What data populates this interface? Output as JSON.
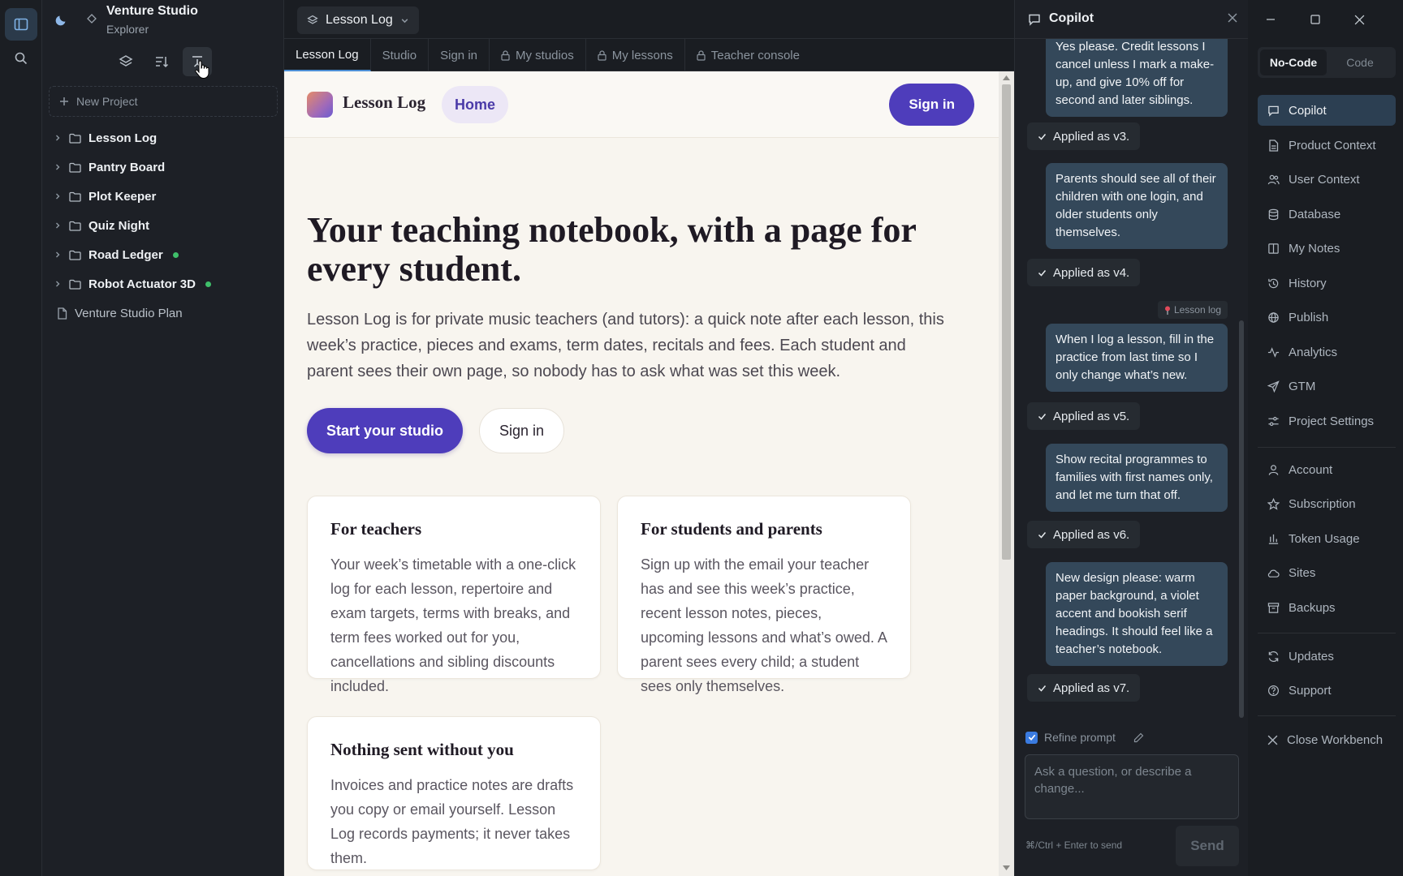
{
  "explorer": {
    "title": "Venture Studio",
    "subtitle": "Explorer",
    "new_project": "New Project",
    "projects": [
      {
        "name": "Lesson Log",
        "dot": false
      },
      {
        "name": "Pantry Board",
        "dot": false
      },
      {
        "name": "Plot Keeper",
        "dot": false
      },
      {
        "name": "Quiz Night",
        "dot": false
      },
      {
        "name": "Road Ledger",
        "dot": true
      },
      {
        "name": "Robot Actuator 3D",
        "dot": true
      }
    ],
    "doc": "Venture Studio Plan"
  },
  "center": {
    "project_select": "Lesson Log",
    "tabs": [
      {
        "label": "Lesson Log",
        "locked": false,
        "active": true
      },
      {
        "label": "Studio",
        "locked": false,
        "active": false
      },
      {
        "label": "Sign in",
        "locked": false,
        "active": false
      },
      {
        "label": "My studios",
        "locked": true,
        "active": false
      },
      {
        "label": "My lessons",
        "locked": true,
        "active": false
      },
      {
        "label": "Teacher console",
        "locked": true,
        "active": false
      }
    ]
  },
  "site": {
    "logo": "Lesson Log",
    "home": "Home",
    "nav_signin": "Sign in",
    "hero_title": "Your teaching notebook, with a page for every student.",
    "hero_body": "Lesson Log is for private music teachers (and tutors): a quick note after each lesson, this week’s practice, pieces and exams, term dates, recitals and fees. Each student and parent sees their own page, so nobody has to ask what was set this week.",
    "cta_primary": "Start your studio",
    "cta_secondary": "Sign in",
    "cards": [
      {
        "title": "For teachers",
        "body": "Your week’s timetable with a one-click log for each lesson, repertoire and exam targets, terms with breaks, and term fees worked out for you, cancellations and sibling discounts included."
      },
      {
        "title": "For students and parents",
        "body": "Sign up with the email your teacher has and see this week’s practice, recent lesson notes, pieces, upcoming lessons and what’s owed. A parent sees every child; a student sees only themselves."
      },
      {
        "title": "Nothing sent without you",
        "body": "Invoices and practice notes are drafts you copy or email yourself. Lesson Log records payments; it never takes them."
      }
    ],
    "accent": "#4e3dbb"
  },
  "copilot": {
    "title": "Copilot",
    "messages": {
      "m1": "Yes please. Credit lessons I cancel unless I mark a make-up, and give 10% off for second and later siblings.",
      "a3": "Applied as v3.",
      "m2": "Parents should see all of their children with one login, and older students only themselves.",
      "a4": "Applied as v4.",
      "ctx": "Lesson log",
      "m3": "When I log a lesson, fill in the practice from last time so I only change what’s new.",
      "a5": "Applied as v5.",
      "m4": "Show recital programmes to families with first names only, and let me turn that off.",
      "a6": "Applied as v6.",
      "m5": "New design please: warm paper background, a violet accent and bookish serif headings. It should feel like a teacher’s notebook.",
      "a7": "Applied as v7."
    },
    "refine_label": "Refine prompt",
    "refine_checked": true,
    "input_placeholder": "Ask a question, or describe a change...",
    "hint": "⌘/Ctrl + Enter to send",
    "send": "Send"
  },
  "rightnav": {
    "mode_nocode": "No-Code",
    "mode_code": "Code",
    "items": [
      {
        "label": "Copilot",
        "icon": "chat-icon"
      },
      {
        "label": "Product Context",
        "icon": "document-icon"
      },
      {
        "label": "User Context",
        "icon": "users-icon"
      },
      {
        "label": "Database",
        "icon": "database-icon"
      },
      {
        "label": "My Notes",
        "icon": "book-icon"
      },
      {
        "label": "History",
        "icon": "history-icon"
      },
      {
        "label": "Publish",
        "icon": "globe-icon"
      },
      {
        "label": "Analytics",
        "icon": "activity-icon"
      },
      {
        "label": "GTM",
        "icon": "send-icon"
      },
      {
        "label": "Project Settings",
        "icon": "sliders-icon"
      },
      {
        "label": "Account",
        "icon": "user-icon"
      },
      {
        "label": "Subscription",
        "icon": "star-icon"
      },
      {
        "label": "Token Usage",
        "icon": "bar-chart-icon"
      },
      {
        "label": "Sites",
        "icon": "cloud-icon"
      },
      {
        "label": "Backups",
        "icon": "archive-icon"
      },
      {
        "label": "Updates",
        "icon": "refresh-icon"
      },
      {
        "label": "Support",
        "icon": "help-icon"
      },
      {
        "label": "Close Workbench",
        "icon": "close-icon"
      }
    ]
  }
}
